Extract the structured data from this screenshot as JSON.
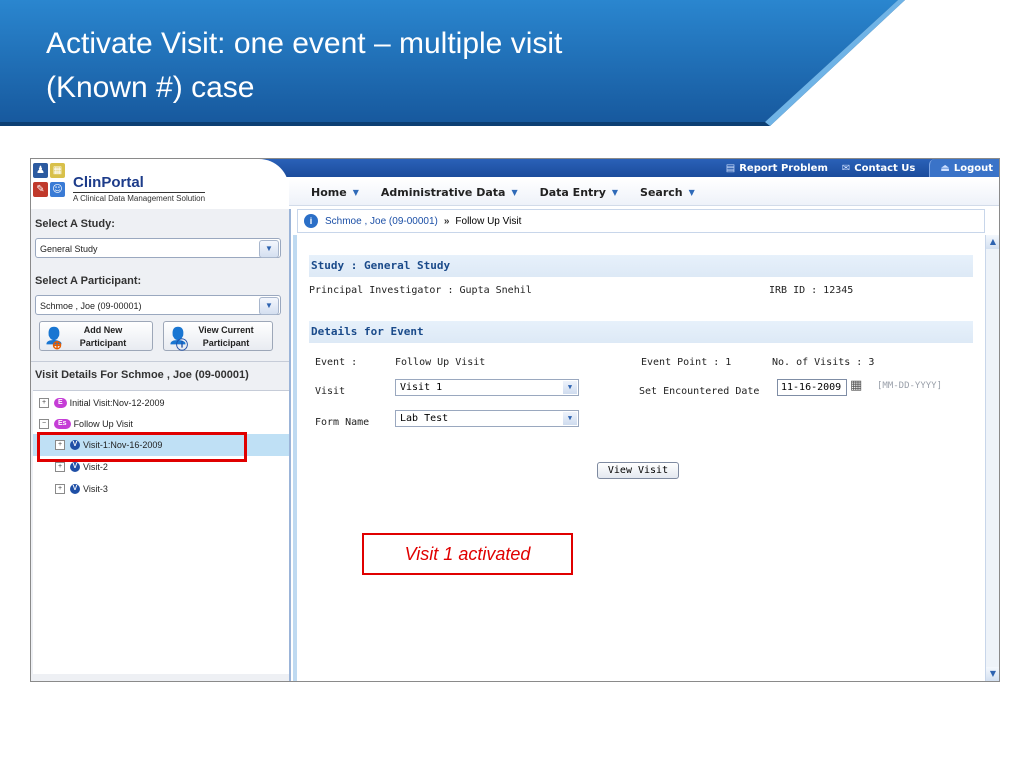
{
  "slide": {
    "title_line1": "Activate Visit: one event – multiple visit",
    "title_line2": "(Known #) case"
  },
  "app": {
    "logo": {
      "name": "ClinPortal",
      "tagline": "A Clinical Data Management Solution"
    },
    "toplinks": {
      "report": "Report Problem",
      "contact": "Contact Us",
      "logout": "Logout"
    },
    "nav": [
      "Home",
      "Administrative Data",
      "Data Entry",
      "Search"
    ],
    "sidebar": {
      "study_label": "Select A Study:",
      "study_value": "General Study",
      "participant_label": "Select A Participant:",
      "participant_value": "Schmoe , Joe (09-00001)",
      "add_btn_line1": "Add New",
      "add_btn_line2": "Participant",
      "view_btn_line1": "View Current",
      "view_btn_line2": "Participant",
      "visit_details": "Visit Details For  Schmoe , Joe (09-00001)",
      "tree": {
        "initial_badge": "E",
        "initial": "Initial Visit:Nov-12-2009",
        "follow_badge": "Es",
        "follow": "Follow Up Visit",
        "visit_badge": "V",
        "visit1": "Visit-1:Nov-16-2009",
        "visit2": "Visit-2",
        "visit3": "Visit-3"
      }
    },
    "breadcrumb": {
      "participant": "Schmoe , Joe (09-00001)",
      "separator": "»",
      "current": "Follow Up Visit"
    },
    "main": {
      "study_head": "Study : General Study",
      "pi": "Principal Investigator : Gupta Snehil",
      "irb": "IRB ID : 12345",
      "details_head": "Details for Event",
      "event_label": "Event :",
      "event_value": "Follow Up Visit",
      "event_point": "Event Point : 1",
      "num_visits": "No. of Visits : 3",
      "visit_label": "Visit",
      "visit_value": "Visit 1",
      "encounter_label": "Set Encountered Date",
      "encounter_date": "11-16-2009",
      "date_format": "[MM-DD-YYYY]",
      "form_label": "Form Name",
      "form_value": "Lab Test",
      "view_visit": "View Visit"
    }
  },
  "callout": "Visit 1 activated",
  "colors": {
    "banner": "#1d6fb8",
    "highlight": "#e00000",
    "accent": "#1b4fa6"
  }
}
